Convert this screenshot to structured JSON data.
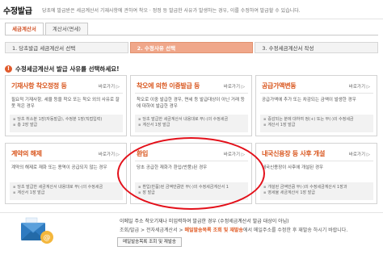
{
  "header": {
    "title": "수정발급",
    "description": "당초에 발급받은 세금계산서 기재사항에 관하여 착오 · 정정 등 발급한 사유가 발생하는 경우, 이를 수정하여 발급할 수 있습니다."
  },
  "tabs": [
    {
      "label": "세금계산서"
    },
    {
      "label": "계산서(면세)"
    }
  ],
  "steps": [
    {
      "label": "1. 당초발급 세금계산서 선택"
    },
    {
      "label": "2. 수정사유 선택"
    },
    {
      "label": "3. 수정세금계산서 작성"
    }
  ],
  "prompt": "수정세금계산서 발급 사유를 선택하세요!",
  "shortcut_label": "바로가기 ▷",
  "cards": [
    {
      "title": "기재사항 착오정정 등",
      "body": "필요적 기재사항, 세율 등을 착오 또는 착오 외의 사유로 잘못 적은 경우",
      "foot1": "당초 취소분 1장(자동발급), 수정분 1장(직접입력)",
      "foot2": "총 2장 발급"
    },
    {
      "title": "착오에 의한 이중발급 등",
      "body": "착오로 이중 발급한 경우, 면세 등 발급대상이 아닌 거래 등에 대하여 발급한 경우",
      "foot1": "당초 발급한 세금계산서 내용대로 부(-)의 수정세금",
      "foot2": "계산서 1장 발급"
    },
    {
      "title": "공급가액변동",
      "body": "공급가액에 추가 또는 차감되는 금액이 발생한 경우",
      "foot1": "증감되는 분에 대하여 정(+) 또는 부(-)의 수정세금",
      "foot2": "계산서 1장 발급"
    },
    {
      "title": "계약의 해제",
      "body": "계약의 해제로 재화 또는 용역이 공급되지 않는 경우",
      "foot1": "당초 발급한 세금계산서 내용대로 부(-)의 수정세금",
      "foot2": "계산서 1장 발급"
    },
    {
      "title": "환입",
      "body": "당초 공급한 재화가 환입(반품)된 경우",
      "foot1": "환입(반품)된 금액만큼만 부(-)의 수정세금계산서 1",
      "foot2": "장 발급"
    },
    {
      "title": "내국신용장 등 사후 개설",
      "body": "내국신용장이 사후에 개설된 경우",
      "foot1": "개설된 금액만큼 부(-)의 수정세금계산서 1장과",
      "foot2": "영세율 세금계산서 1장 발급"
    }
  ],
  "mailbox": {
    "line1": "이메일 주소 착오기재나 미입력하여 발급한 경우 (수정세금계산서 발급 대상이 아님)",
    "line2_prefix": "조회/발급 > 전자세금계산서 > ",
    "line2_highlight": "메일발송목록 조회 및 재발송",
    "line2_suffix": "에서 메일주소를 수정한 후 재발송 하시기 바랍니다.",
    "button_label": "메일발송목록 조회 및 재발송"
  },
  "colors": {
    "accent": "#d9571f",
    "step_active": "#f0a78a",
    "highlight_ring": "#e3101a"
  }
}
